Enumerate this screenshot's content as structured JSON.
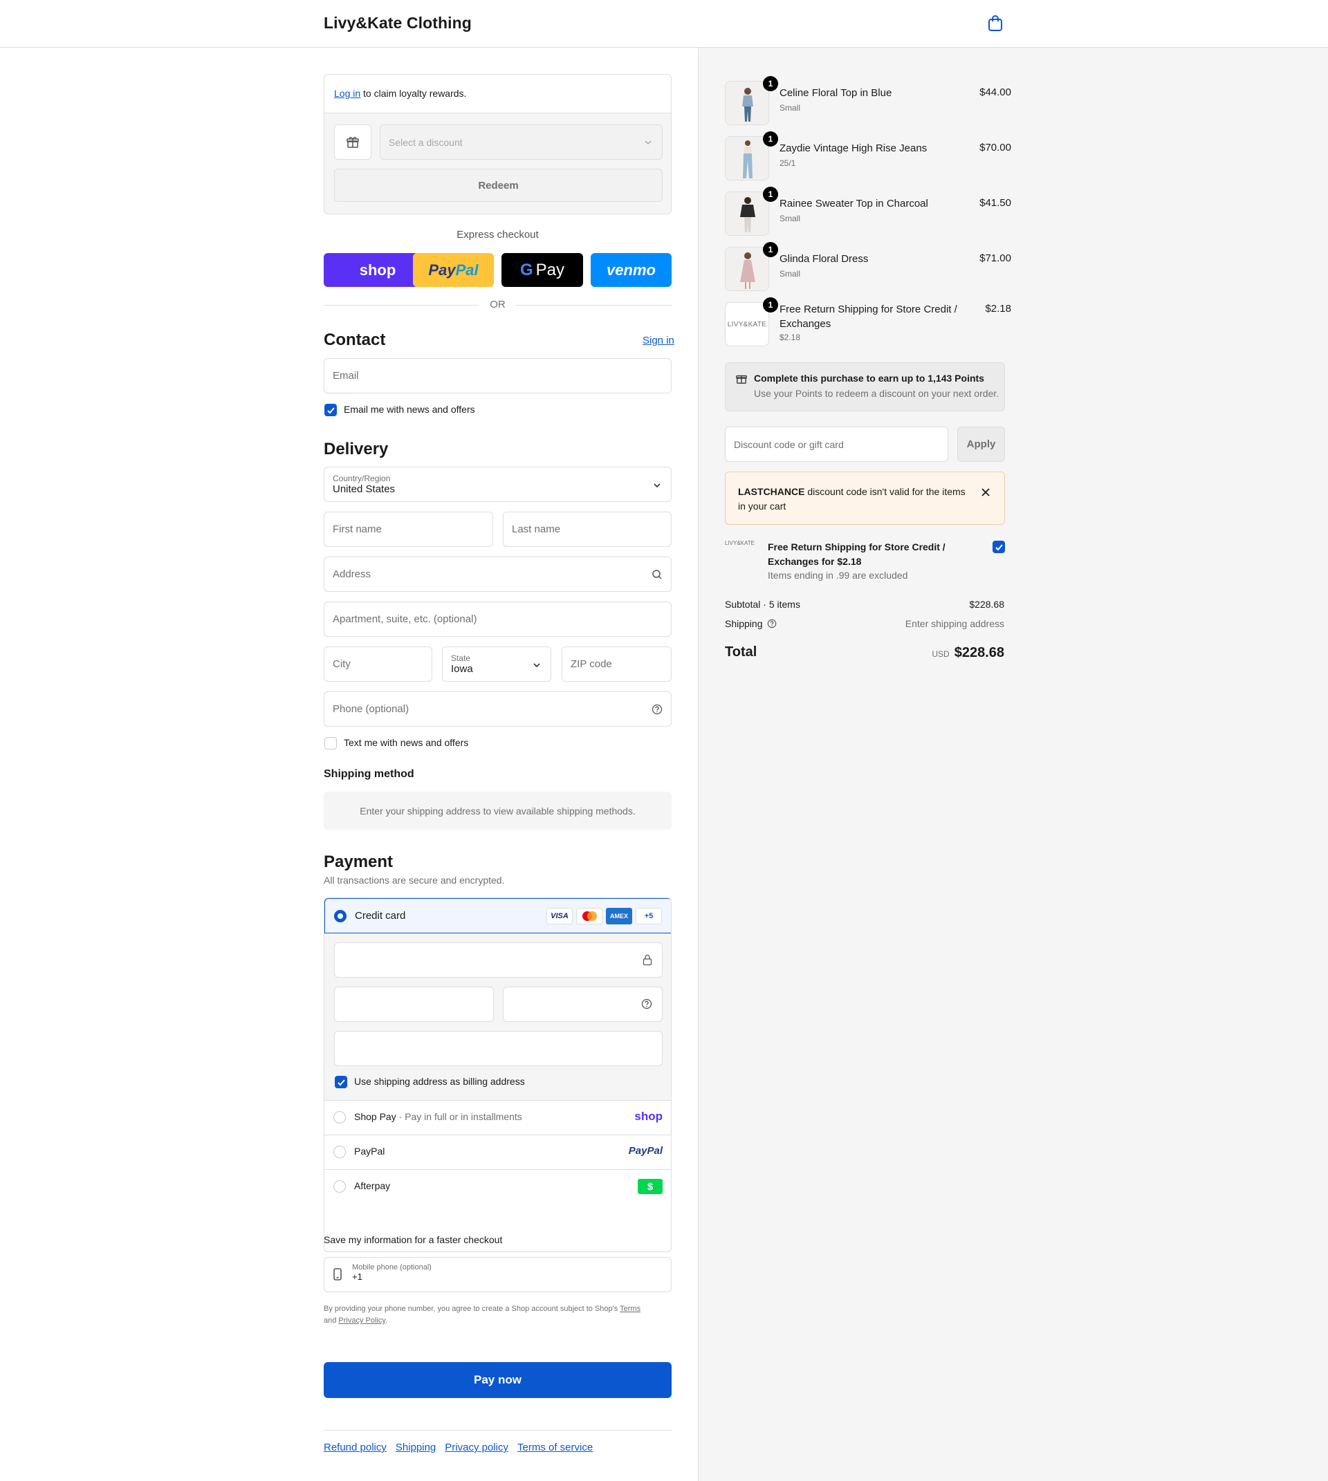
{
  "header": {
    "brand": "Livy&Kate Clothing"
  },
  "loyalty": {
    "login_link": "Log in",
    "login_rest": "to claim loyalty rewards.",
    "select_placeholder": "Select a discount",
    "redeem": "Redeem"
  },
  "express": {
    "label": "Express checkout",
    "shop": "shop",
    "paypal_a": "Pay",
    "paypal_b": "Pal",
    "gpay": "Pay",
    "venmo": "venmo",
    "or": "OR"
  },
  "contact": {
    "title": "Contact",
    "sign_in": "Sign in",
    "email_placeholder": "Email",
    "news_label": "Email me with news and offers"
  },
  "delivery": {
    "title": "Delivery",
    "country_label": "Country/Region",
    "country_value": "United States",
    "first_name": "First name",
    "last_name": "Last name",
    "address": "Address",
    "apartment": "Apartment, suite, etc. (optional)",
    "city": "City",
    "state_label": "State",
    "state_value": "Iowa",
    "zip": "ZIP code",
    "phone": "Phone (optional)",
    "text_label": "Text me with news and offers"
  },
  "shipping_method": {
    "title": "Shipping method",
    "message": "Enter your shipping address to view available shipping methods."
  },
  "payment": {
    "title": "Payment",
    "subtitle": "All transactions are secure and encrypted.",
    "credit_card": "Credit card",
    "visa": "VISA",
    "amex": "AMEX",
    "more": "+5",
    "billing_label": "Use shipping address as billing address",
    "shop_pay": "Shop Pay",
    "shop_pay_sep": "·",
    "shop_pay_note": "Pay in full or in installments",
    "shop_logo": "shop",
    "paypal": "PayPal",
    "paypal_logo": "PayPal",
    "afterpay": "Afterpay",
    "afterpay_logo": "$"
  },
  "save_info": {
    "title": "Save my information for a faster checkout",
    "mobile_label": "Mobile phone (optional)",
    "mobile_value": "+1",
    "terms_a": "By providing your phone number, you agree to create a Shop account subject to Shop's",
    "terms_link": "Terms",
    "terms_b": "and",
    "privacy_link": "Privacy Policy",
    "terms_end": "."
  },
  "pay_now": "Pay now",
  "footer": [
    "Refund policy",
    "Shipping",
    "Privacy policy",
    "Terms of service"
  ],
  "cart": {
    "items": [
      {
        "name": "Celine Floral Top in Blue",
        "variant": "Small",
        "price": "$44.00",
        "qty": "1"
      },
      {
        "name": "Zaydie Vintage High Rise Jeans",
        "variant": "25/1",
        "price": "$70.00",
        "qty": "1"
      },
      {
        "name": "Rainee Sweater Top in Charcoal",
        "variant": "Small",
        "price": "$41.50",
        "qty": "1"
      },
      {
        "name": "Glinda Floral Dress",
        "variant": "Small",
        "price": "$71.00",
        "qty": "1"
      },
      {
        "name": "Free Return Shipping for Store Credit / Exchanges",
        "variant": "$2.18",
        "price": "$2.18",
        "qty": "1",
        "logo": "LIVY&KATE"
      }
    ],
    "points_title": "Complete this purchase to earn up to 1,143 Points",
    "points_sub": "Use your Points to redeem a discount on your next order.",
    "discount_placeholder": "Discount code or gift card",
    "apply": "Apply",
    "error_code": "LASTCHANCE",
    "error_rest": "discount code isn't valid for the items in your cart",
    "upsell_logo": "LIVY&KATE",
    "upsell_title": "Free Return Shipping for Store Credit / Exchanges for $2.18",
    "upsell_note": "Items ending in .99 are excluded",
    "subtotal_label": "Subtotal · 5 items",
    "subtotal_value": "$228.68",
    "shipping_label": "Shipping",
    "shipping_value": "Enter shipping address",
    "total_label": "Total",
    "currency": "USD",
    "total_value": "$228.68"
  },
  "colors": {
    "accent": "#0b57d0",
    "shop": "#5a31f4",
    "paypal": "#ffc439",
    "venmo": "#008cff",
    "afterpay": "#00d64f"
  }
}
